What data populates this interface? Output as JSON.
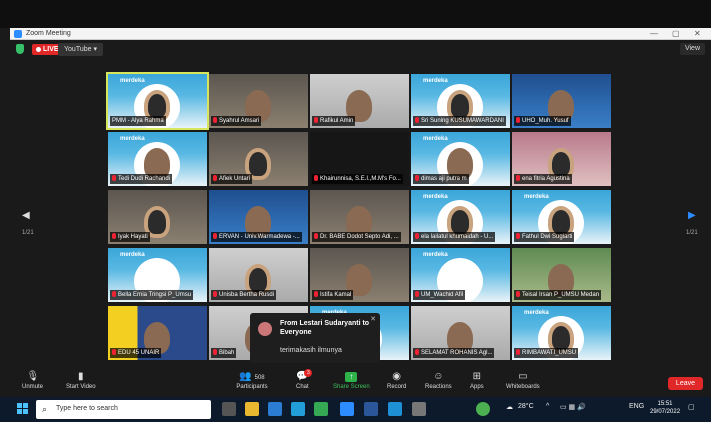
{
  "window": {
    "title": "Zoom Meeting",
    "controls": [
      "—",
      "▢",
      "✕"
    ]
  },
  "header": {
    "live_label": "LIVE",
    "stream_label": "YouTube ▾",
    "view_label": "View"
  },
  "grid": {
    "page_left": "1/21",
    "page_right": "1/21",
    "tiles": [
      {
        "name": "PMM - Alya Rahma",
        "bg": "merdeka",
        "face": "hijab",
        "active": true,
        "muted": false
      },
      {
        "name": "Syahrul Amsari",
        "bg": "room",
        "face": "plain",
        "muted": true
      },
      {
        "name": "Rafikul Amin",
        "bg": "grey",
        "face": "plain",
        "muted": true
      },
      {
        "name": "Sri Suning KUSUMAWARDANI",
        "bg": "merdeka",
        "face": "hijab",
        "muted": true
      },
      {
        "name": "UHO_Muh. Yusuf",
        "bg": "blue",
        "face": "plain",
        "muted": true
      },
      {
        "name": "Tedi Dudi Rachandi",
        "bg": "merdeka",
        "face": "plain",
        "muted": true
      },
      {
        "name": "Afiek Untari",
        "bg": "room",
        "face": "hijab",
        "muted": true
      },
      {
        "name": "Khairunnisa, S.E.I.,M.M's Fo...",
        "bg": "dark",
        "face": "none",
        "muted": true
      },
      {
        "name": "dimas aji putra m",
        "bg": "merdeka",
        "face": "plain",
        "muted": true
      },
      {
        "name": "ena fitria Agustina",
        "bg": "pink",
        "face": "hijab",
        "muted": true
      },
      {
        "name": "Iyak Hayati",
        "bg": "room",
        "face": "hijab",
        "muted": true
      },
      {
        "name": "ERVAN - Univ.Warmadewa -...",
        "bg": "blue",
        "face": "plain",
        "muted": true
      },
      {
        "name": "Dr. BABE Dodot Septo Adi, ...",
        "bg": "room",
        "face": "plain",
        "muted": true
      },
      {
        "name": "ela lailatul khumaidah - U...",
        "bg": "merdeka",
        "face": "hijab",
        "muted": true
      },
      {
        "name": "Fathul Dwi Sugiarti",
        "bg": "merdeka",
        "face": "hijab",
        "muted": true
      },
      {
        "name": "Bella Ernia Tringsi P_Umsu",
        "bg": "merdeka",
        "face": "none",
        "muted": true
      },
      {
        "name": "Unisba Bertha Rusdi",
        "bg": "grey",
        "face": "hijab",
        "muted": true
      },
      {
        "name": "Istifa Kamal",
        "bg": "room",
        "face": "plain",
        "muted": true
      },
      {
        "name": "UM_Wachid Afil",
        "bg": "merdeka",
        "face": "none",
        "muted": true
      },
      {
        "name": "Teisal Irsan P_UMSU Medan",
        "bg": "green",
        "face": "plain",
        "muted": true
      },
      {
        "name": "EDU 45 UNAIR",
        "bg": "yellow",
        "face": "plain",
        "muted": true
      },
      {
        "name": "Bibah",
        "bg": "grey",
        "face": "plain",
        "muted": true
      },
      {
        "name": "",
        "bg": "merdeka",
        "face": "none",
        "muted": false
      },
      {
        "name": "SELAMAT ROHANIS Agl...",
        "bg": "grey",
        "face": "plain",
        "muted": true
      },
      {
        "name": "RIMBAWATI_UMSU",
        "bg": "merdeka",
        "face": "hijab",
        "muted": true
      }
    ]
  },
  "chat_popup": {
    "from": "From Lestari Sudaryanti to Everyone",
    "message": "terimakasih ilmunya"
  },
  "toolbar": {
    "unmute": "Unmute",
    "start_video": "Start Video",
    "participants": "Participants",
    "participants_count": "508",
    "chat": "Chat",
    "chat_badge": "3",
    "share_screen": "Share Screen",
    "record": "Record",
    "reactions": "Reactions",
    "apps": "Apps",
    "whiteboards": "Whiteboards",
    "leave": "Leave"
  },
  "taskbar": {
    "search_placeholder": "Type here to search",
    "weather": "28°C",
    "lang": "ENG",
    "time": "15:51",
    "date": "29/07/2022"
  }
}
